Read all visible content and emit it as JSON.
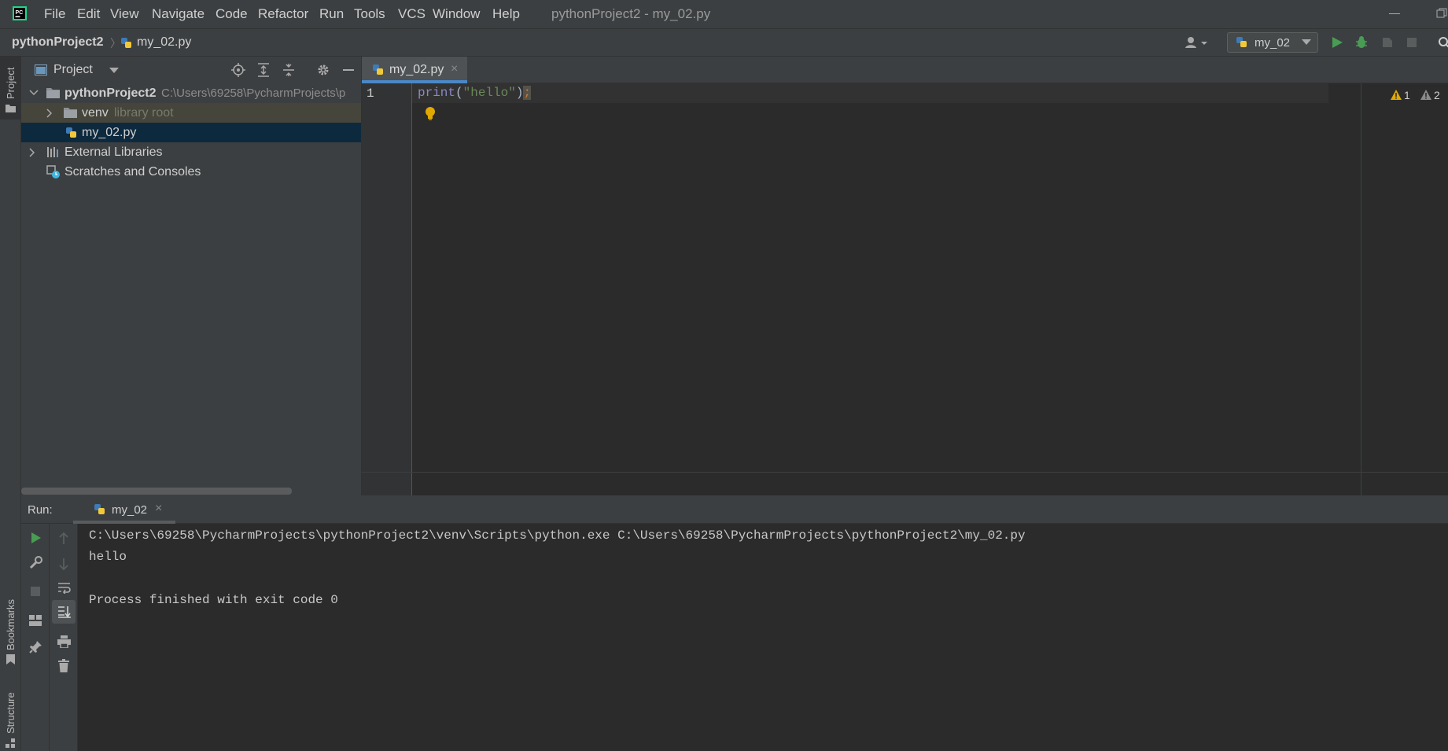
{
  "menu": {
    "items": [
      "File",
      "Edit",
      "View",
      "Navigate",
      "Code",
      "Refactor",
      "Run",
      "Tools",
      "VCS",
      "Window",
      "Help"
    ],
    "window_title": "pythonProject2 - my_02.py"
  },
  "navbar": {
    "project": "pythonProject2",
    "file": "my_02.py",
    "run_config": "my_02"
  },
  "side_tabs": {
    "project": "Project",
    "bookmarks": "Bookmarks",
    "structure": "Structure"
  },
  "project_panel": {
    "title": "Project",
    "tree": {
      "root_name": "pythonProject2",
      "root_path": "C:\\Users\\69258\\PycharmProjects\\p",
      "venv_name": "venv",
      "venv_hint": "library root",
      "file": "my_02.py",
      "external": "External Libraries",
      "scratches": "Scratches and Consoles"
    }
  },
  "editor": {
    "tab": "my_02.py",
    "line_number": "1",
    "code": {
      "fn": "print",
      "open": "(",
      "str": "\"hello\"",
      "close": ")",
      "semi": ";"
    },
    "warnings": "1",
    "weak_warnings": "2"
  },
  "run_panel": {
    "label": "Run:",
    "tab": "my_02",
    "console": {
      "cmd": "C:\\Users\\69258\\PycharmProjects\\pythonProject2\\venv\\Scripts\\python.exe C:\\Users\\69258\\PycharmProjects\\pythonProject2\\my_02.py",
      "output": "hello",
      "exit": "Process finished with exit code 0"
    }
  },
  "colors": {
    "background": "#2b2b2b",
    "panel": "#3c3f41",
    "selection": "#0d293e",
    "accent_tab": "#4a88c7",
    "run_green": "#499c54",
    "warning": "#e0a800"
  }
}
